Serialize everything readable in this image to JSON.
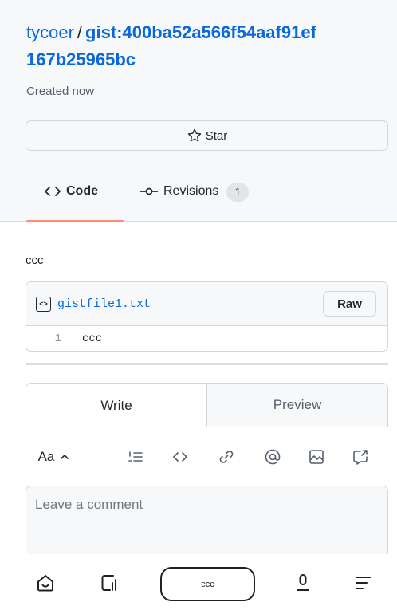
{
  "header": {
    "owner": "tycoer",
    "separator": "/",
    "gist_id_line1": "gist:400ba52a566f54aaf91ef",
    "gist_id_line2": "167b25965bc",
    "created": "Created now",
    "star_label": "Star"
  },
  "tabs": [
    {
      "label": "Code",
      "active": true
    },
    {
      "label": "Revisions",
      "count": "1",
      "active": false
    }
  ],
  "gist": {
    "description": "ccc",
    "file_icon": "<>",
    "file_name": "gistfile1.txt",
    "raw_label": "Raw",
    "lines": [
      {
        "number": "1",
        "code": "ccc"
      }
    ]
  },
  "comment": {
    "tabs": [
      "Write",
      "Preview"
    ],
    "format_label": "Aa",
    "placeholder": "Leave a comment"
  },
  "bottom_nav": {
    "pill_label": "ccc"
  },
  "colors": {
    "link": "#0969da",
    "active_tab_underline": "#fd8c73",
    "header_bg": "#f6f8fa",
    "border": "#d0d7de"
  }
}
